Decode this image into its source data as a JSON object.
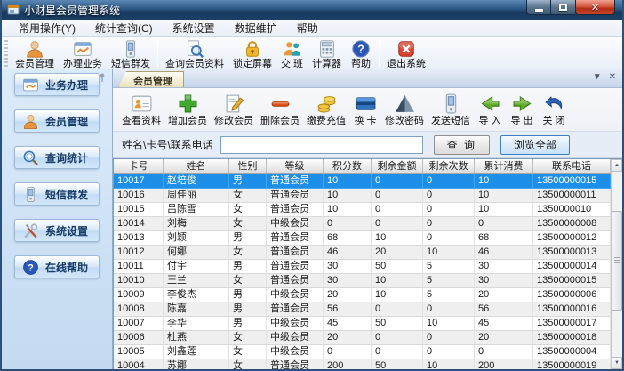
{
  "window": {
    "title": "小财星会员管理系统",
    "controls": {
      "minimize": "minimize",
      "maximize": "maximize",
      "close": "close"
    }
  },
  "menu_bar": {
    "items": [
      "常用操作(Y)",
      "统计查询(C)",
      "系统设置",
      "数据维护",
      "帮助"
    ]
  },
  "main_toolbar": {
    "items": [
      {
        "label": "会员管理",
        "icon": "member-person-icon"
      },
      {
        "label": "办理业务",
        "icon": "business-chart-icon"
      },
      {
        "label": "短信群发",
        "icon": "sms-phone-icon"
      },
      {
        "label": "查询会员资料",
        "icon": "search-document-icon"
      },
      {
        "label": "锁定屏幕",
        "icon": "lock-icon"
      },
      {
        "label": "交 班",
        "icon": "shift-change-icon"
      },
      {
        "label": "计算器",
        "icon": "calculator-icon"
      },
      {
        "label": "帮助",
        "icon": "help-icon"
      },
      {
        "label": "退出系统",
        "icon": "exit-icon"
      }
    ]
  },
  "sidebar": {
    "items": [
      {
        "label": "业务办理",
        "icon": "business-icon"
      },
      {
        "label": "会员管理",
        "icon": "member-icon"
      },
      {
        "label": "查询统计",
        "icon": "query-stats-icon"
      },
      {
        "label": "短信群发",
        "icon": "sms-icon"
      },
      {
        "label": "系统设置",
        "icon": "settings-icon"
      },
      {
        "label": "在线帮助",
        "icon": "online-help-icon"
      }
    ]
  },
  "tab_strip": {
    "active_tab": "会员管理"
  },
  "member_toolbar": {
    "items": [
      {
        "label": "查看资料",
        "icon": "view-profile-icon"
      },
      {
        "label": "增加会员",
        "icon": "add-member-icon"
      },
      {
        "label": "修改会员",
        "icon": "edit-member-icon"
      },
      {
        "label": "删除会员",
        "icon": "delete-member-icon"
      },
      {
        "label": "缴费充值",
        "icon": "recharge-icon"
      },
      {
        "label": "换 卡",
        "icon": "change-card-icon"
      },
      {
        "label": "修改密码",
        "icon": "change-password-icon"
      },
      {
        "label": "发送短信",
        "icon": "send-sms-icon"
      },
      {
        "label": "导 入",
        "icon": "import-icon"
      },
      {
        "label": "导 出",
        "icon": "export-icon"
      },
      {
        "label": "关 闭",
        "icon": "close-panel-icon"
      }
    ]
  },
  "search_bar": {
    "label": "姓名\\卡号\\联系电话",
    "input_value": "",
    "query_button": "查 询",
    "browse_all_button": "浏览全部"
  },
  "table": {
    "columns": [
      "卡号",
      "姓名",
      "性别",
      "等级",
      "积分数",
      "剩余金额",
      "剩余次数",
      "累计消费",
      "联系电话"
    ],
    "selected_row_index": 0,
    "rows": [
      [
        "10017",
        "赵培俊",
        "男",
        "普通会员",
        "10",
        "0",
        "0",
        "10",
        "13500000015"
      ],
      [
        "10016",
        "周佳丽",
        "女",
        "普通会员",
        "10",
        "0",
        "0",
        "10",
        "13500000011"
      ],
      [
        "10015",
        "吕陈雪",
        "女",
        "普通会员",
        "10",
        "0",
        "0",
        "10",
        "1350000010"
      ],
      [
        "10014",
        "刘梅",
        "女",
        "中级会员",
        "0",
        "0",
        "0",
        "0",
        "13500000008"
      ],
      [
        "10013",
        "刘颖",
        "男",
        "普通会员",
        "68",
        "10",
        "0",
        "68",
        "13500000012"
      ],
      [
        "10012",
        "何娜",
        "女",
        "普通会员",
        "46",
        "20",
        "10",
        "46",
        "13500000013"
      ],
      [
        "10011",
        "付宇",
        "男",
        "普通会员",
        "30",
        "50",
        "5",
        "30",
        "13500000014"
      ],
      [
        "10010",
        "王兰",
        "女",
        "普通会员",
        "30",
        "10",
        "5",
        "30",
        "13500000015"
      ],
      [
        "10009",
        "李俊杰",
        "男",
        "中级会员",
        "20",
        "10",
        "5",
        "20",
        "13500000006"
      ],
      [
        "10008",
        "陈嘉",
        "男",
        "普通会员",
        "56",
        "0",
        "0",
        "56",
        "13500000016"
      ],
      [
        "10007",
        "李华",
        "男",
        "中级会员",
        "45",
        "50",
        "10",
        "45",
        "13500000017"
      ],
      [
        "10006",
        "杜燕",
        "女",
        "中级会员",
        "20",
        "0",
        "0",
        "20",
        "13500000018"
      ],
      [
        "10005",
        "刘鑫莲",
        "女",
        "中级会员",
        "0",
        "0",
        "0",
        "0",
        "13500000004"
      ],
      [
        "10004",
        "苏娜",
        "女",
        "普通会员",
        "200",
        "50",
        "10",
        "200",
        "13500000019"
      ]
    ]
  },
  "colors": {
    "title_bar": "#1b4066",
    "selected_row": "#1e8fe9",
    "accent_blue": "#3a80c4",
    "tab_active_bg": "#f3ead0",
    "sidebar_bg": "#c3daf1"
  }
}
